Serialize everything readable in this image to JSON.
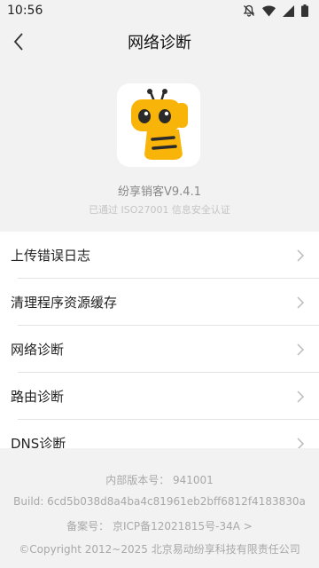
{
  "status_bar": {
    "time": "10:56",
    "icons": [
      "notification-off-icon",
      "wifi-icon",
      "signal-icon",
      "battery-icon"
    ]
  },
  "header": {
    "title": "网络诊断",
    "back_icon": "chevron-left-icon"
  },
  "app_info": {
    "name_version": "纷享销客V9.4.1",
    "certification": "已通过 ISO27001 信息安全认证"
  },
  "menu": {
    "items": [
      {
        "label": "上传错误日志"
      },
      {
        "label": "清理程序资源缓存"
      },
      {
        "label": "网络诊断"
      },
      {
        "label": "路由诊断"
      },
      {
        "label": "DNS诊断"
      }
    ]
  },
  "footer": {
    "internal_version": "内部版本号： 941001",
    "build": "Build: 6cd5b038d8a4ba4c81961eb2bff6812f4183830a",
    "icp": "备案号： 京ICP备12021815号-34A >",
    "copyright": "©Copyright 2012~2025 北京易动纷享科技有限责任公司"
  },
  "colors": {
    "background": "#f2f2f2",
    "mascot_yellow": "#f9b409",
    "mascot_dark": "#2a2a2a"
  }
}
